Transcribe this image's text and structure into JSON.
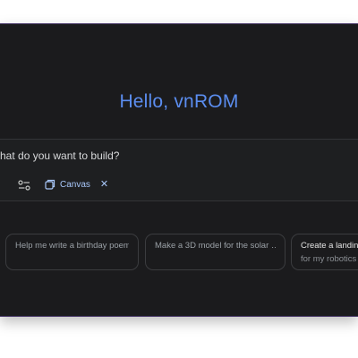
{
  "greeting": "Hello, vnROM",
  "prompt": {
    "placeholder": "hat do you want to build?"
  },
  "toolbar": {
    "tools_icon": "sliders-icon",
    "canvas_chip": {
      "label": "Canvas",
      "icon": "canvas-icon",
      "close": "✕"
    }
  },
  "suggestions": [
    {
      "title": "Help me write a birthday poem"
    },
    {
      "title": "Make a 3D model for the solar …"
    },
    {
      "title": "Create a landing",
      "subtitle": "for my robotics"
    }
  ],
  "colors": {
    "background": "#1b1b1d",
    "accent": "#5b8def",
    "chip": "#a8c7fa"
  }
}
